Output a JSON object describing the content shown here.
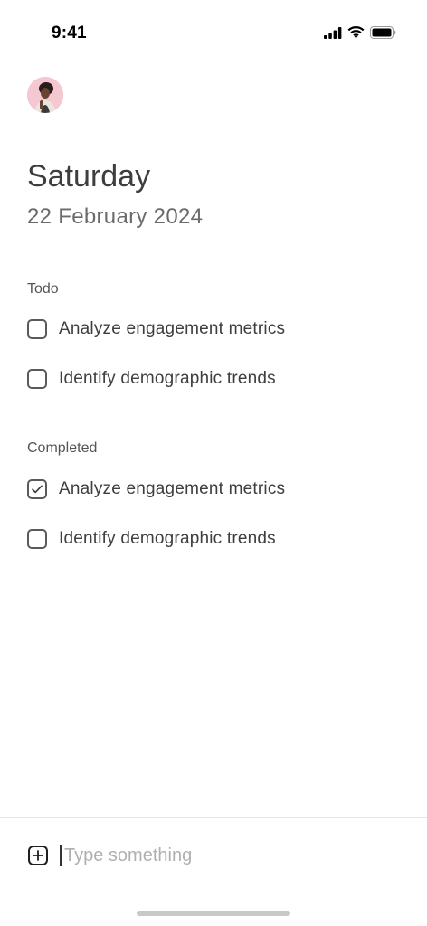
{
  "status_bar": {
    "time": "9:41"
  },
  "header": {
    "day": "Saturday",
    "date": "22 February 2024"
  },
  "todo": {
    "title": "Todo",
    "items": [
      {
        "label": "Analyze engagement metrics",
        "checked": false
      },
      {
        "label": "Identify demographic trends",
        "checked": false
      }
    ]
  },
  "completed": {
    "title": "Completed",
    "items": [
      {
        "label": "Analyze engagement metrics",
        "checked": true
      },
      {
        "label": "Identify demographic trends",
        "checked": false
      }
    ]
  },
  "composer": {
    "placeholder": "Type something",
    "add_icon": "plus-square-icon"
  },
  "colors": {
    "text": "#3e3e3e",
    "subtext": "#6b6b6b",
    "placeholder": "#b0b0b0"
  }
}
